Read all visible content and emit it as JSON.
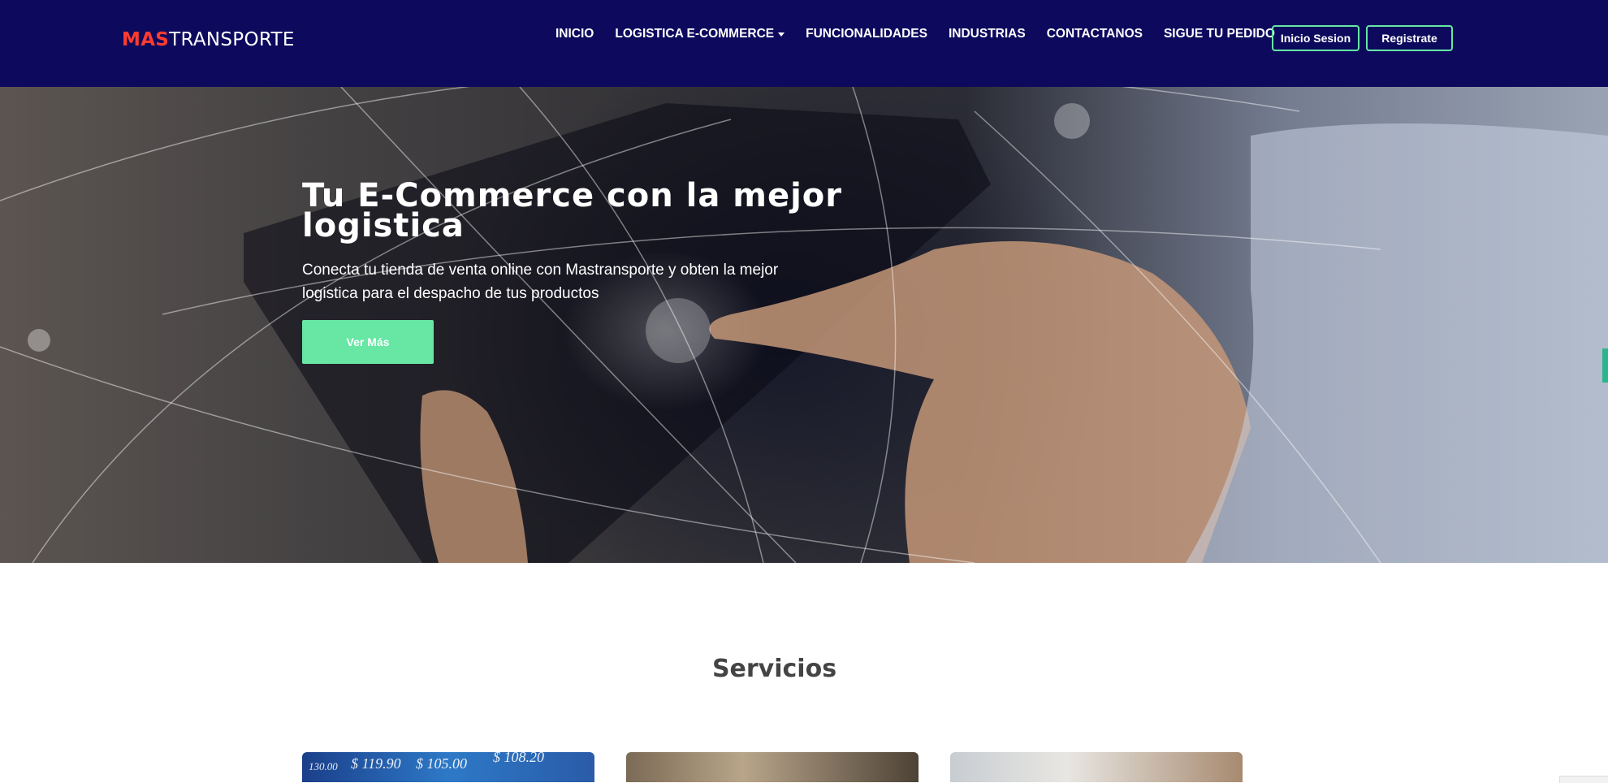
{
  "brand": {
    "part1": "MAS",
    "part2": "TRANSPORTE",
    "colors": {
      "accent": "#ff3b30",
      "nav_bg": "#0d0a5e",
      "green": "#67e6a4"
    }
  },
  "nav": {
    "items": [
      {
        "label": "INICIO"
      },
      {
        "label": "LOGISTICA E-COMMERCE",
        "has_dropdown": true
      },
      {
        "label": "FUNCIONALIDADES"
      },
      {
        "label": "INDUSTRIAS"
      },
      {
        "label": "CONTACTANOS"
      },
      {
        "label": "SIGUE TU PEDIDO"
      }
    ],
    "login_label": "Inicio Sesion",
    "register_label": "Registrate"
  },
  "hero": {
    "title": "Tu E-Commerce con la mejor logistica",
    "subtitle": "Conecta tu tienda de venta online con Mastransporte y obten la mejor logistica para el despacho de tus productos",
    "button_label": "Ver Más"
  },
  "services": {
    "title": "Servicios",
    "card1_prices": [
      "130.00",
      "$ 119.90",
      "$ 105.00",
      "$ 108.20"
    ]
  }
}
